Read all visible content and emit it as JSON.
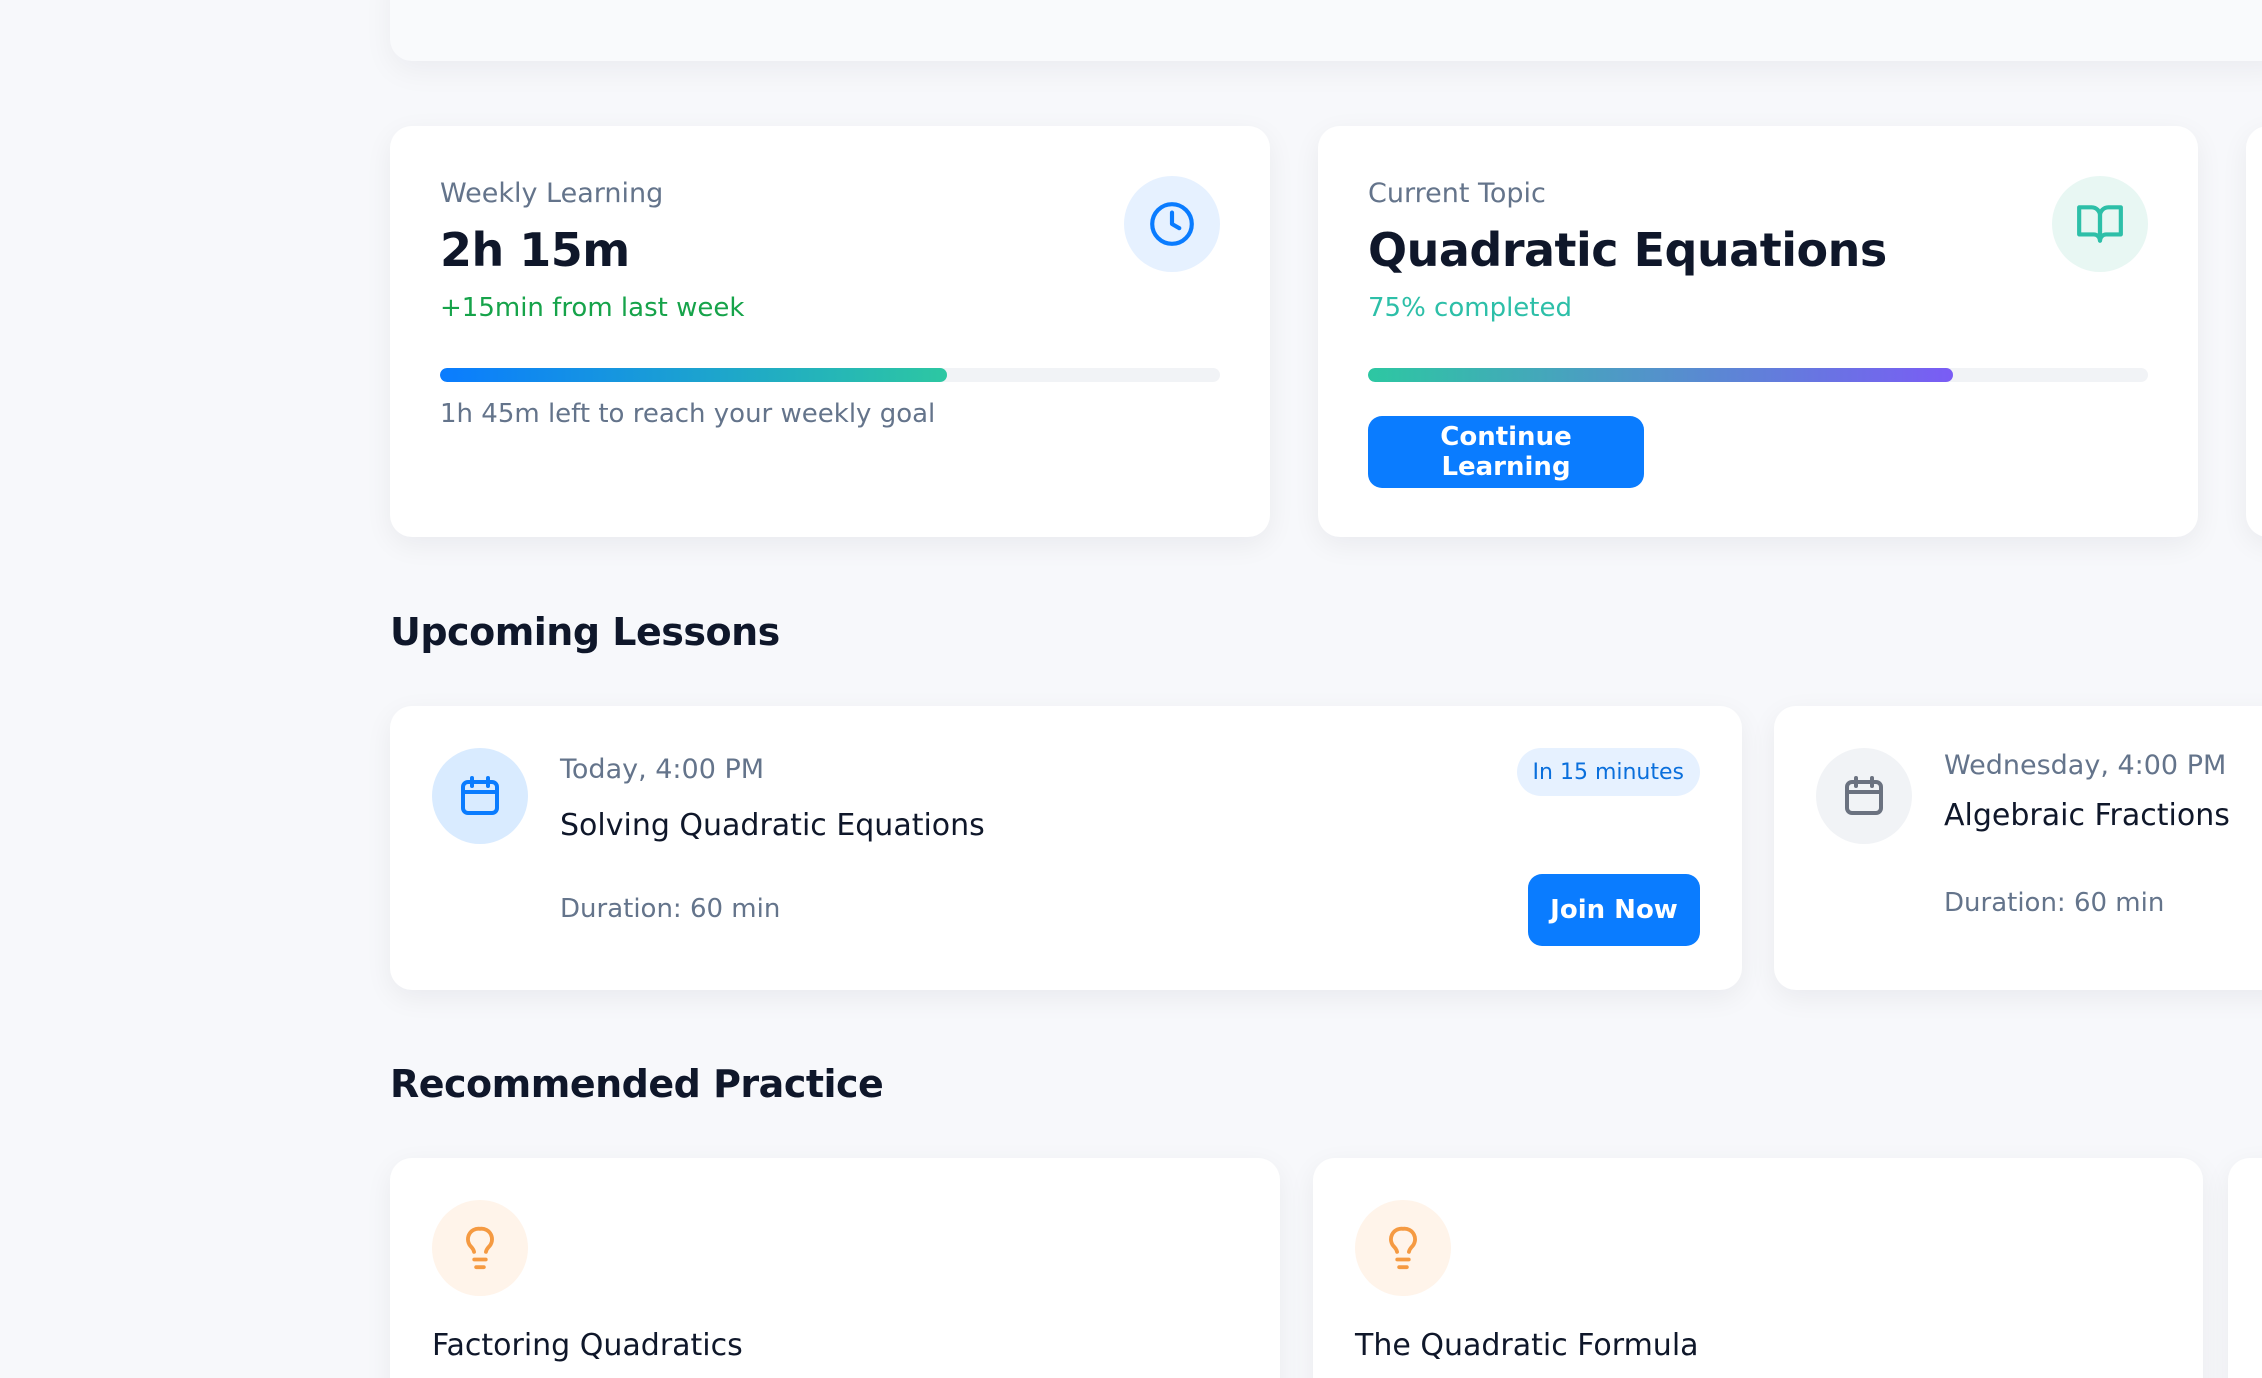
{
  "weekly_learning": {
    "label": "Weekly Learning",
    "value": "2h 15m",
    "delta": "+15min from last week",
    "progress": 0.65,
    "footnote": "1h 45m left to reach your weekly goal",
    "icon": "clock-icon"
  },
  "current_topic": {
    "label": "Current Topic",
    "value": "Quadratic Equations",
    "status": "75% completed",
    "progress": 0.75,
    "button_label": "Continue Learning",
    "icon": "book-open-icon"
  },
  "upcoming": {
    "title": "Upcoming Lessons",
    "lessons": [
      {
        "time": "Today, 4:00 PM",
        "title": "Solving Quadratic Equations",
        "duration": "Duration: 60 min",
        "badge": "In 15 minutes",
        "button_label": "Join Now",
        "icon": "calendar-icon"
      },
      {
        "time": "Wednesday, 4:00 PM",
        "title": "Algebraic Fractions",
        "duration": "Duration: 60 min",
        "icon": "calendar-icon"
      }
    ]
  },
  "recommended": {
    "title": "Recommended Practice",
    "items": [
      {
        "title": "Factoring Quadratics",
        "icon": "lightbulb-icon"
      },
      {
        "title": "The Quadratic Formula",
        "icon": "lightbulb-icon"
      }
    ]
  },
  "colors": {
    "primary": "#0a7cff",
    "success": "#16a34a",
    "teal": "#2dbfa8",
    "purple": "#7a5cf5",
    "orange": "#f59a42",
    "muted": "#64748b"
  }
}
